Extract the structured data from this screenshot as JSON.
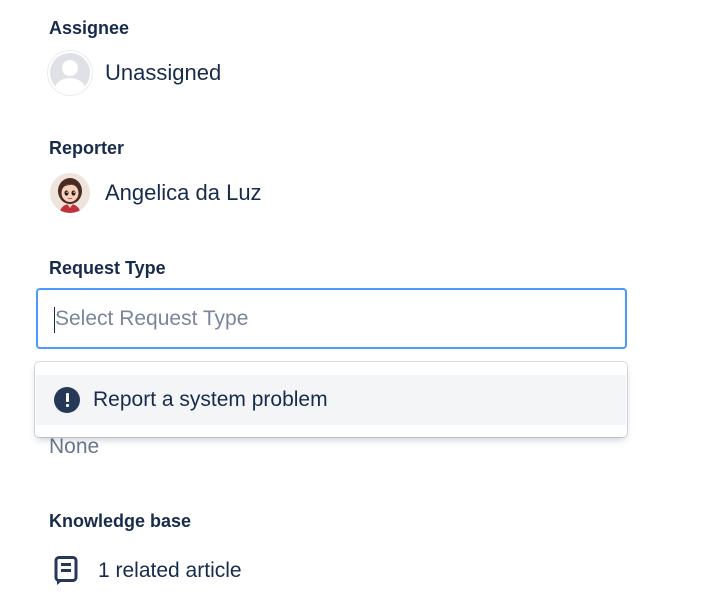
{
  "assignee": {
    "label": "Assignee",
    "value": "Unassigned",
    "avatar_icon": "person-placeholder-icon"
  },
  "reporter": {
    "label": "Reporter",
    "value": "Angelica da Luz",
    "avatar_icon": "user-avatar"
  },
  "request_type": {
    "label": "Request Type",
    "placeholder": "Select Request Type",
    "options": [
      {
        "label": "Report a system problem",
        "icon": "exclamation-circle-icon"
      }
    ]
  },
  "hidden_field": {
    "value": "None"
  },
  "knowledge_base": {
    "label": "Knowledge base",
    "link_text": "1 related article",
    "icon": "article-icon"
  },
  "colors": {
    "text": "#172b4d",
    "focus_border": "#4c9aff",
    "option_highlight": "#f4f5f7",
    "muted_text": "#6b778c"
  }
}
